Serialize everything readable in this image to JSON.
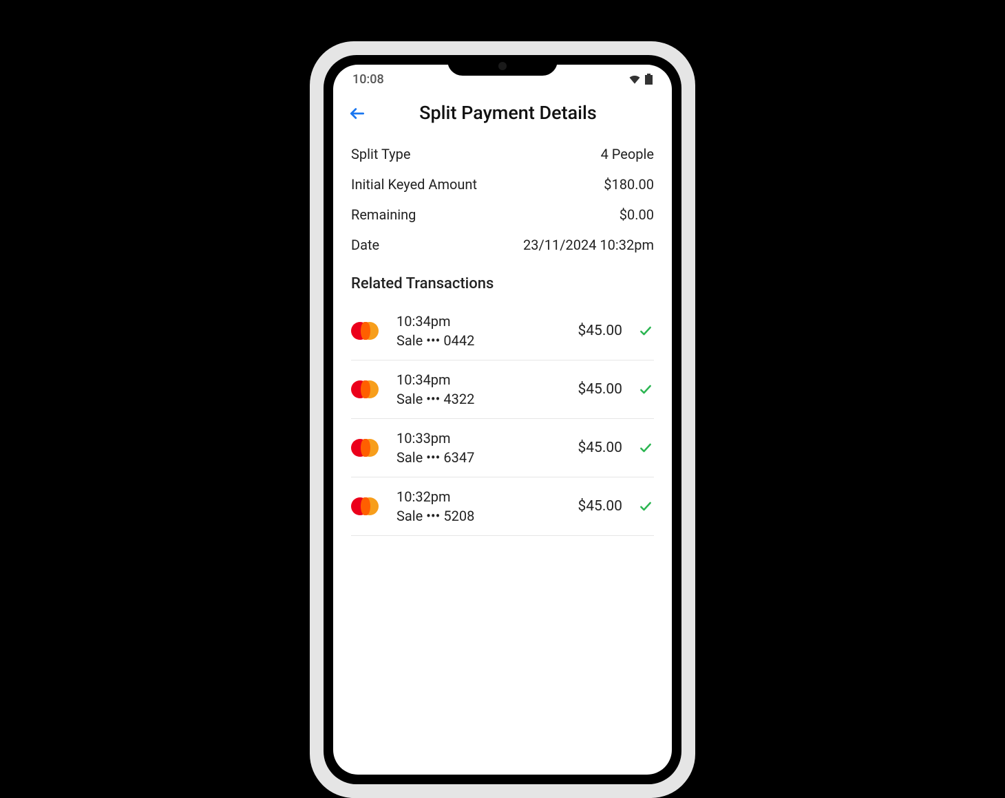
{
  "status_bar": {
    "time": "10:08"
  },
  "header": {
    "title": "Split Payment Details"
  },
  "summary": {
    "rows": [
      {
        "label": "Split Type",
        "value": "4 People"
      },
      {
        "label": "Initial Keyed Amount",
        "value": "$180.00"
      },
      {
        "label": "Remaining",
        "value": "$0.00"
      },
      {
        "label": "Date",
        "value": "23/11/2024 10:32pm"
      }
    ]
  },
  "section_title": "Related Transactions",
  "transactions": [
    {
      "time": "10:34pm",
      "desc": "Sale ••• 0442",
      "amount": "$45.00",
      "brand": "mastercard",
      "status": "success"
    },
    {
      "time": "10:34pm",
      "desc": "Sale ••• 4322",
      "amount": "$45.00",
      "brand": "mastercard",
      "status": "success"
    },
    {
      "time": "10:33pm",
      "desc": "Sale ••• 6347",
      "amount": "$45.00",
      "brand": "mastercard",
      "status": "success"
    },
    {
      "time": "10:32pm",
      "desc": "Sale ••• 5208",
      "amount": "$45.00",
      "brand": "mastercard",
      "status": "success"
    }
  ]
}
